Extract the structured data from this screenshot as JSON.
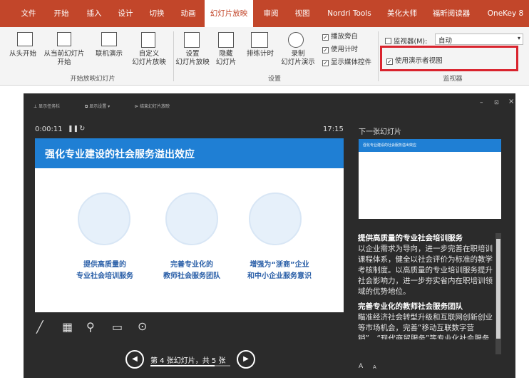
{
  "tabs": [
    {
      "label": "文件",
      "active": false
    },
    {
      "label": "开始",
      "active": false
    },
    {
      "label": "插入",
      "active": false
    },
    {
      "label": "设计",
      "active": false
    },
    {
      "label": "切换",
      "active": false
    },
    {
      "label": "动画",
      "active": false
    },
    {
      "label": "幻灯片放映",
      "active": true
    },
    {
      "label": "审阅",
      "active": false
    },
    {
      "label": "视图",
      "active": false
    },
    {
      "label": "Nordri Tools",
      "active": false
    },
    {
      "label": "美化大师",
      "active": false
    },
    {
      "label": "福昕阅读器",
      "active": false
    },
    {
      "label": "OneKey 8",
      "active": false
    }
  ],
  "ribbon": {
    "from_start": "从头开始",
    "from_current": "从当前幻灯片\n开始",
    "online": "联机演示",
    "custom": "自定义\n幻灯片放映",
    "group_start": "开始放映幻灯片",
    "setup": "设置\n幻灯片放映",
    "hide": "隐藏\n幻灯片",
    "rehearse": "排练计时",
    "record": "录制\n幻灯片演示",
    "cb_narration": "播放旁白",
    "cb_timing": "使用计时",
    "cb_media": "显示媒体控件",
    "group_setup": "设置",
    "monitor_label": "监视器(M):",
    "monitor_value": "自动",
    "presenter_view": "使用演示者视图",
    "group_monitor": "监视器"
  },
  "presenter": {
    "top_taskbar": "显示任务栏",
    "top_display": "显示设置 ▾",
    "top_end": "结束幻灯片放映",
    "timer": "0:00:11",
    "clock": "17:15",
    "next_label": "下一张幻灯片",
    "slide_title": "强化专业建设的社会服务溢出效应",
    "caps": [
      "提供高质量的\n专业社会培训服务",
      "完善专业化的\n教师社会服务团队",
      "增强为“浙商”企业\n和中小企业服务意识"
    ],
    "next_title": "强化专业建设的社会服务溢出效应",
    "nav_text": "第 4 张幻灯片，共 5 张",
    "notes_h1": "提供高质量的专业社会培训服务",
    "notes_p1": "以企业需求为导向，进一步完善在职培训课程体系，健全以社会评价为标准的教学考核制度。以高质量的专业培训服务提升社会影响力，进一步夯实省内在职培训领域的优势地位。",
    "notes_h2": "完善专业化的教师社会服务团队",
    "notes_p2": "瞄准经济社会转型升级和互联网创新创业等市场机会，完善“移动互联数字营销”、“现代商贸服务”等专业化社会服务团队，实现科研、教学成果的有效转化",
    "font_up": "A",
    "font_down": "A"
  }
}
